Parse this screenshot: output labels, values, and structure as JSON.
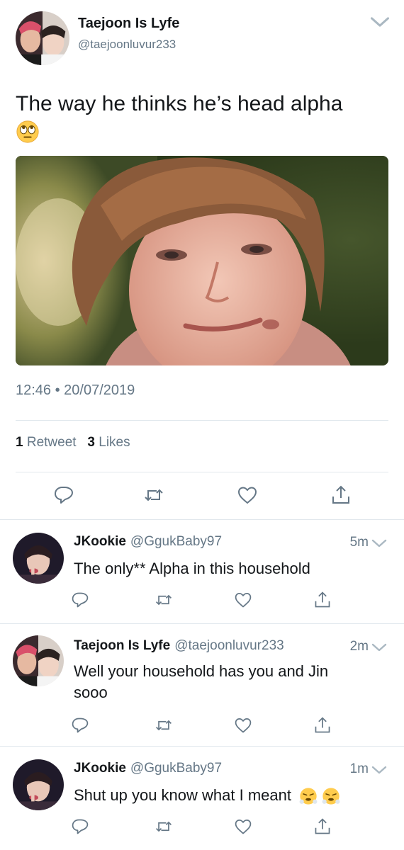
{
  "main_tweet": {
    "author_name": "Taejoon Is Lyfe",
    "handle": "@taejoonluvur233",
    "text": "The way he thinks he’s head alpha",
    "emoji": "rolling-eyes-emoji",
    "timestamp": "12:46 • 20/07/2019",
    "retweet_count": "1",
    "retweet_label": "Retweet",
    "like_count": "3",
    "like_label": "Likes"
  },
  "replies": [
    {
      "author_name": "JKookie",
      "handle": "@GgukBaby97",
      "time": "5m",
      "text": "The only** Alpha in this household"
    },
    {
      "author_name": "Taejoon Is Lyfe",
      "handle": "@taejoonluvur233",
      "time": "2m",
      "text_line1": "Well your household has you and Jin",
      "text_line2": "sooo"
    },
    {
      "author_name": "JKookie",
      "handle": "@GgukBaby97",
      "time": "1m",
      "text": "Shut up you know what I meant",
      "emoji": "face-with-steam-emoji"
    }
  ],
  "icons": {
    "reply": "reply-icon",
    "retweet": "retweet-icon",
    "like": "heart-icon",
    "share": "share-icon",
    "more": "chevron-down-icon"
  },
  "colors": {
    "text_primary": "#14171a",
    "text_secondary": "#657786",
    "divider": "#e1e8ed",
    "icon": "#657786"
  }
}
